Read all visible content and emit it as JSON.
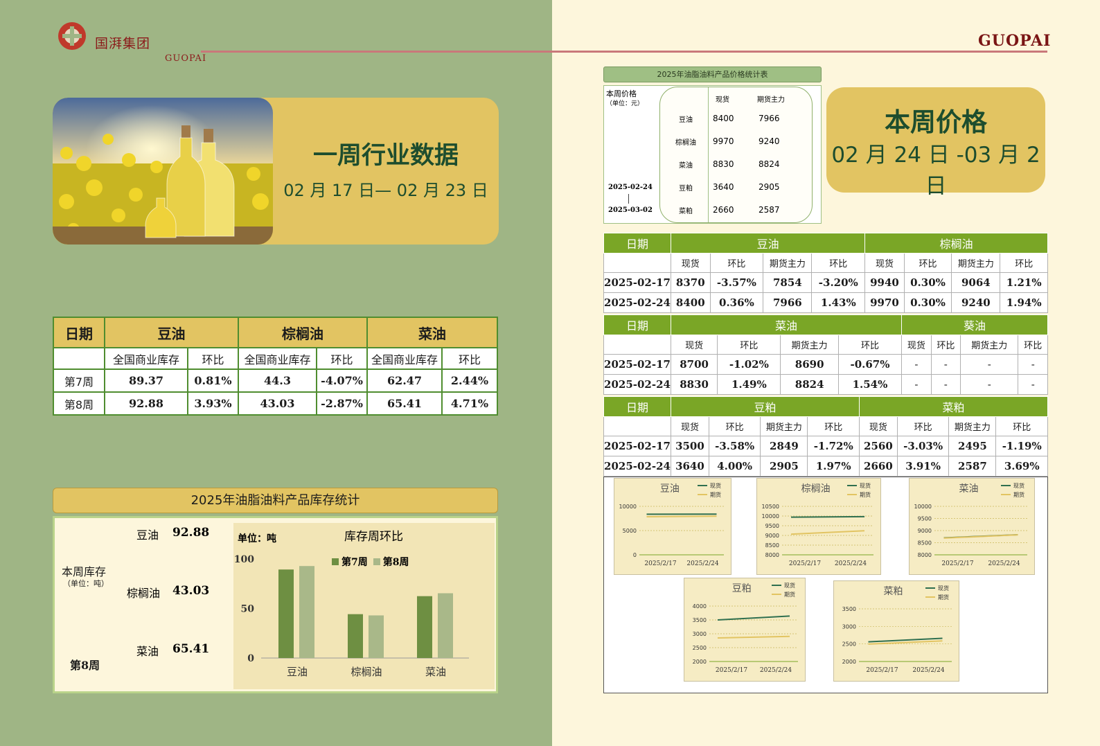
{
  "brand": {
    "cn": "国湃集团",
    "en": "GUOPAI",
    "right": "GUOPAI"
  },
  "hero": {
    "title": "一周行业数据",
    "date": "02 月 17 日— 02 月 23 日"
  },
  "inventory_table": {
    "header": {
      "date": "日期",
      "g1": "豆油",
      "g2": "棕榈油",
      "g3": "菜油"
    },
    "sub": [
      "全国商业库存",
      "环比",
      "全国商业库存",
      "环比",
      "全国商业库存",
      "环比"
    ],
    "rows": [
      {
        "label": "第7周",
        "cells": [
          "89.37",
          "0.81%",
          "44.3",
          "-4.07%",
          "62.47",
          "2.44%"
        ]
      },
      {
        "label": "第8周",
        "cells": [
          "92.88",
          "3.93%",
          "43.03",
          "-2.87%",
          "65.41",
          "4.71%"
        ]
      }
    ]
  },
  "stock": {
    "title": "2025年油脂油料产品库存统计",
    "this_week": "本周库存",
    "unit": "（单位：吨）",
    "week": "第8周",
    "items": [
      {
        "name": "豆油",
        "value": "92.88"
      },
      {
        "name": "棕榈油",
        "value": "43.03"
      },
      {
        "name": "菜油",
        "value": "65.41"
      }
    ],
    "chart_unit": "单位：吨",
    "chart_title": "库存周环比",
    "legend": [
      "第7周",
      "第8周"
    ]
  },
  "mini_table": {
    "title": "2025年油脂油料产品价格统计表",
    "label": "本周价格",
    "unit": "（单位：元）",
    "col1": "现货",
    "col2": "期货主力",
    "date_start": "2025-02-24",
    "date_end": "2025-03-02",
    "rows": [
      {
        "name": "豆油",
        "spot": "8400",
        "fut": "7966"
      },
      {
        "name": "棕榈油",
        "spot": "9970",
        "fut": "9240"
      },
      {
        "name": "菜油",
        "spot": "8830",
        "fut": "8824"
      },
      {
        "name": "豆粕",
        "spot": "3640",
        "fut": "2905"
      },
      {
        "name": "菜粕",
        "spot": "2660",
        "fut": "2587"
      }
    ]
  },
  "price_card": {
    "title": "本周价格",
    "date": "02 月 24 日 -03 月 2 日"
  },
  "price_tables": [
    {
      "date": "日期",
      "g1": "豆油",
      "g2": "棕榈油",
      "sub": [
        "现货",
        "环比",
        "期货主力",
        "环比",
        "现货",
        "环比",
        "期货主力",
        "环比"
      ],
      "rows": [
        {
          "date": "2025-02-17",
          "cells": [
            "8370",
            "-3.57%",
            "7854",
            "-3.20%",
            "9940",
            "0.30%",
            "9064",
            "1.21%"
          ]
        },
        {
          "date": "2025-02-24",
          "cells": [
            "8400",
            "0.36%",
            "7966",
            "1.43%",
            "9970",
            "0.30%",
            "9240",
            "1.94%"
          ]
        }
      ]
    },
    {
      "date": "日期",
      "g1": "菜油",
      "g2": "葵油",
      "sub": [
        "现货",
        "环比",
        "期货主力",
        "环比",
        "现货",
        "环比",
        "期货主力",
        "环比"
      ],
      "rows": [
        {
          "date": "2025-02-17",
          "cells": [
            "8700",
            "-1.02%",
            "8690",
            "-0.67%",
            "-",
            "-",
            "-",
            "-"
          ]
        },
        {
          "date": "2025-02-24",
          "cells": [
            "8830",
            "1.49%",
            "8824",
            "1.54%",
            "-",
            "-",
            "-",
            "-"
          ]
        }
      ]
    },
    {
      "date": "日期",
      "g1": "豆粕",
      "g2": "菜粕",
      "sub": [
        "现货",
        "环比",
        "期货主力",
        "环比",
        "现货",
        "环比",
        "期货主力",
        "环比"
      ],
      "rows": [
        {
          "date": "2025-02-17",
          "cells": [
            "3500",
            "-3.58%",
            "2849",
            "-1.72%",
            "2560",
            "-3.03%",
            "2495",
            "-1.19%"
          ]
        },
        {
          "date": "2025-02-24",
          "cells": [
            "3640",
            "4.00%",
            "2905",
            "1.97%",
            "2660",
            "3.91%",
            "2587",
            "3.69%"
          ]
        }
      ]
    }
  ],
  "chart_data": [
    {
      "type": "bar",
      "title": "库存周环比",
      "ylabel": "单位：吨",
      "categories": [
        "豆油",
        "棕榈油",
        "菜油"
      ],
      "ylim": [
        0,
        100
      ],
      "yticks": [
        0,
        50,
        100
      ],
      "series": [
        {
          "name": "第7周",
          "values": [
            89.37,
            44.3,
            62.47
          ],
          "color": "#6e8f42"
        },
        {
          "name": "第8周",
          "values": [
            92.88,
            43.03,
            65.41
          ],
          "color": "#a9b889"
        }
      ]
    },
    {
      "type": "line",
      "title": "豆油",
      "x": [
        "2025/2/17",
        "2025/2/24"
      ],
      "ylim": [
        0,
        10000
      ],
      "yticks": [
        0,
        5000,
        10000
      ],
      "series": [
        {
          "name": "现货",
          "values": [
            8370,
            8400
          ],
          "color": "#2f6f4f"
        },
        {
          "name": "期货",
          "values": [
            7854,
            7966
          ],
          "color": "#e2c462"
        }
      ]
    },
    {
      "type": "line",
      "title": "棕榈油",
      "x": [
        "2025/2/17",
        "2025/2/24"
      ],
      "ylim": [
        8000,
        10500
      ],
      "yticks": [
        8000,
        8500,
        9000,
        9500,
        10000,
        10500
      ],
      "series": [
        {
          "name": "现货",
          "values": [
            9940,
            9970
          ],
          "color": "#2f6f4f"
        },
        {
          "name": "期货",
          "values": [
            9064,
            9240
          ],
          "color": "#e2c462"
        }
      ]
    },
    {
      "type": "line",
      "title": "菜油",
      "x": [
        "2025/2/17",
        "2025/2/24"
      ],
      "ylim": [
        8000,
        10000
      ],
      "yticks": [
        8000,
        8500,
        9000,
        9500,
        10000
      ],
      "series": [
        {
          "name": "现货",
          "values": [
            8700,
            8830
          ],
          "color": "#2f6f4f"
        },
        {
          "name": "期货",
          "values": [
            8690,
            8824
          ],
          "color": "#e2c462"
        }
      ]
    },
    {
      "type": "line",
      "title": "豆粕",
      "x": [
        "2025/2/17",
        "2025/2/24"
      ],
      "ylim": [
        2000,
        4000
      ],
      "yticks": [
        2000,
        2500,
        3000,
        3500,
        4000
      ],
      "series": [
        {
          "name": "现货",
          "values": [
            3500,
            3640
          ],
          "color": "#2f6f4f"
        },
        {
          "name": "期货",
          "values": [
            2849,
            2905
          ],
          "color": "#e2c462"
        }
      ]
    },
    {
      "type": "line",
      "title": "菜粕",
      "x": [
        "2025/2/17",
        "2025/2/24"
      ],
      "ylim": [
        2000,
        3500
      ],
      "yticks": [
        2000,
        2500,
        3000,
        3500
      ],
      "series": [
        {
          "name": "现货",
          "values": [
            2560,
            2660
          ],
          "color": "#2f6f4f"
        },
        {
          "name": "期货",
          "values": [
            2495,
            2587
          ],
          "color": "#e2c462"
        }
      ]
    }
  ]
}
